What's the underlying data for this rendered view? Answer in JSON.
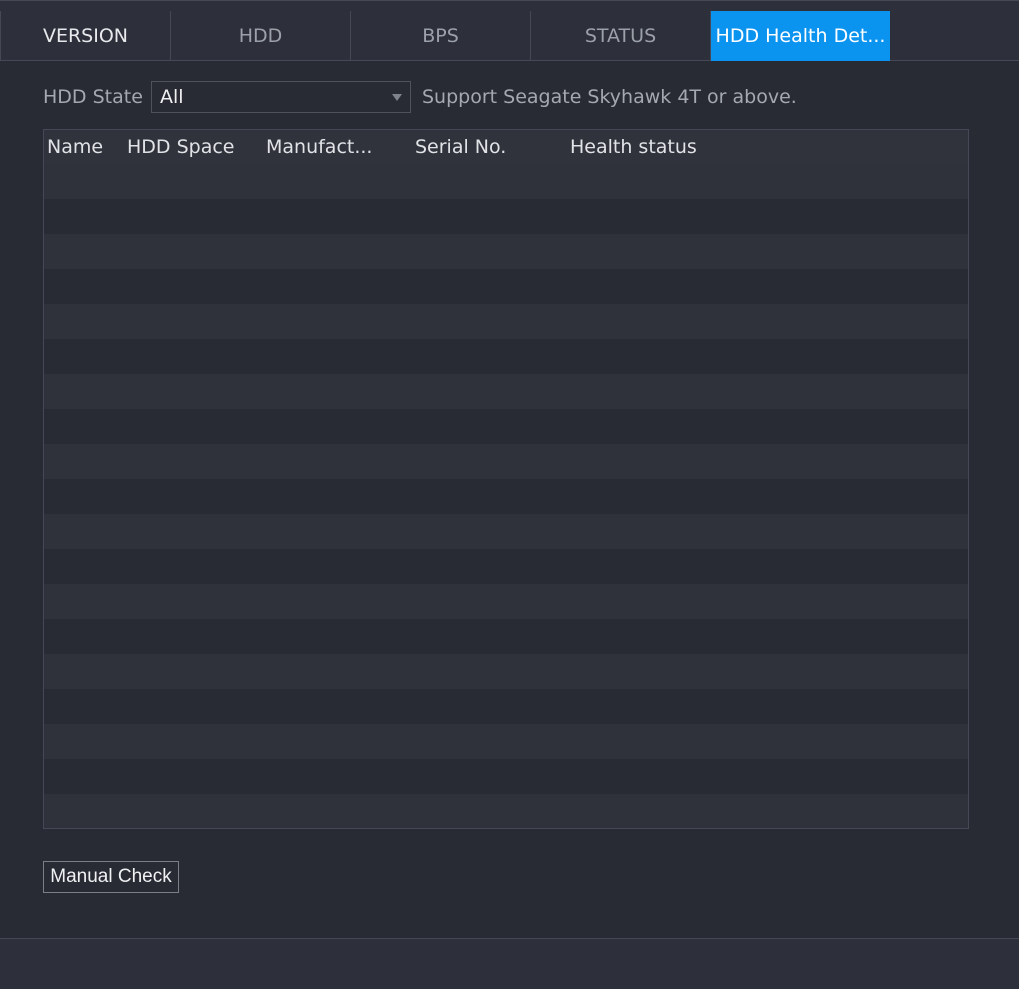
{
  "tabs": [
    {
      "label": "VERSION"
    },
    {
      "label": "HDD"
    },
    {
      "label": "BPS"
    },
    {
      "label": "STATUS"
    },
    {
      "label": "HDD Health Det..."
    }
  ],
  "active_tab_index": 4,
  "filter": {
    "label": "HDD State",
    "selected": "All",
    "note": "Support Seagate Skyhawk 4T or above."
  },
  "table": {
    "columns": [
      "Name",
      "HDD Space",
      "Manufact...",
      "Serial No.",
      "Health status"
    ],
    "rows": []
  },
  "actions": {
    "manual_check": "Manual Check"
  },
  "colors": {
    "background": "#282b34",
    "accent": "#0b93f0",
    "row_alt": "#2f323b",
    "border": "#454955"
  }
}
